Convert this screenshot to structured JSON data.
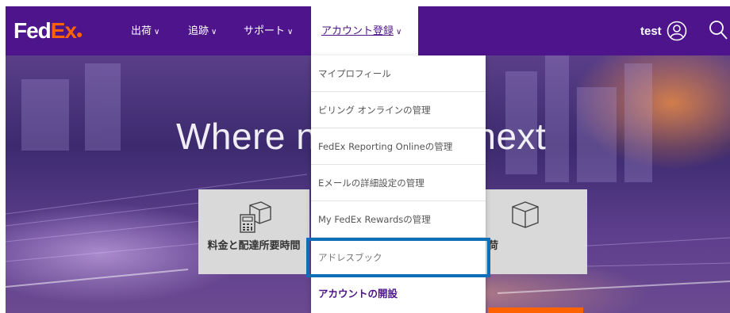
{
  "header": {
    "logo_fed": "Fed",
    "logo_ex": "Ex",
    "nav": [
      {
        "label": "出荷"
      },
      {
        "label": "追跡"
      },
      {
        "label": "サポート"
      },
      {
        "label": "アカウント登録"
      }
    ],
    "user_name": "test"
  },
  "hero": {
    "title_left": "Where n",
    "title_right": "next",
    "tiles": [
      {
        "label": "料金と配達所要時間"
      },
      {
        "label": "荷"
      }
    ]
  },
  "account_menu": {
    "items": [
      {
        "label": "マイプロフィール"
      },
      {
        "label": "ビリング オンラインの管理"
      },
      {
        "label": "FedEx Reporting Onlineの管理"
      },
      {
        "label": "Eメールの詳細設定の管理"
      },
      {
        "label": "My FedEx Rewardsの管理"
      },
      {
        "label": "アドレスブック"
      },
      {
        "label": "アカウントの開設"
      }
    ]
  },
  "colors": {
    "brand_purple": "#4d148c",
    "brand_orange": "#ff6200",
    "focus_blue": "#0d6fb8"
  }
}
